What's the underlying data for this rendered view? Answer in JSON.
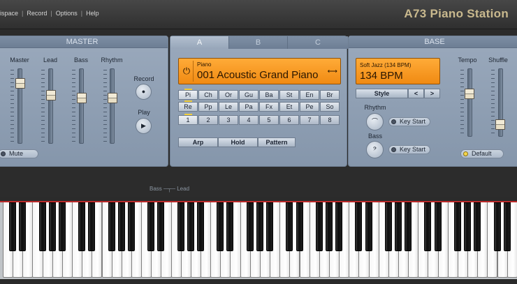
{
  "menu": {
    "items": [
      "ispace",
      "Record",
      "Options",
      "Help"
    ]
  },
  "app": {
    "title": "A73 Piano Station"
  },
  "master": {
    "title": "MASTER",
    "faders": [
      {
        "label": "Master",
        "level": 0.85
      },
      {
        "label": "Lead",
        "level": 0.67
      },
      {
        "label": "Bass",
        "level": 0.62
      },
      {
        "label": "Rhythm",
        "level": 0.62
      }
    ],
    "record_label": "Record",
    "play_label": "Play",
    "mute_label": "Mute",
    "mute_on": false
  },
  "instrument": {
    "tabs": [
      "A",
      "B",
      "C"
    ],
    "active_tab": "A",
    "lcd_label": "Piano",
    "lcd_value": "001 Acoustic Grand Piano",
    "categories": [
      [
        "Pi",
        "Ch",
        "Or",
        "Gu",
        "Ba",
        "St",
        "En",
        "Br"
      ],
      [
        "Re",
        "Pp",
        "Le",
        "Pa",
        "Fx",
        "Et",
        "Pe",
        "So"
      ]
    ],
    "numbers": [
      "1",
      "2",
      "3",
      "4",
      "5",
      "6",
      "7",
      "8"
    ],
    "buttons": [
      "Arp",
      "Hold",
      "Pattern"
    ]
  },
  "base": {
    "title": "BASE",
    "lcd_label": "Soft Jazz (134 BPM)",
    "lcd_value": "134 BPM",
    "style_label": "Style",
    "prev_label": "<",
    "next_label": ">",
    "rhythm_label": "Rhythm",
    "bass_label": "Bass",
    "key_start_1": "Key Start",
    "key_start_2": "Key Start",
    "tempo_label": "Tempo",
    "shuffle_label": "Shuffle",
    "tempo_level": 0.65,
    "shuffle_level": 0.12,
    "default_label": "Default",
    "default_on": true
  },
  "keyboard": {
    "range_label": "Bass ─┬─ Lead",
    "white_keys": 52
  },
  "colors": {
    "lcd": "#f59a1e",
    "panel": "#8fa0b5",
    "accent_text": "#c9b98e"
  }
}
